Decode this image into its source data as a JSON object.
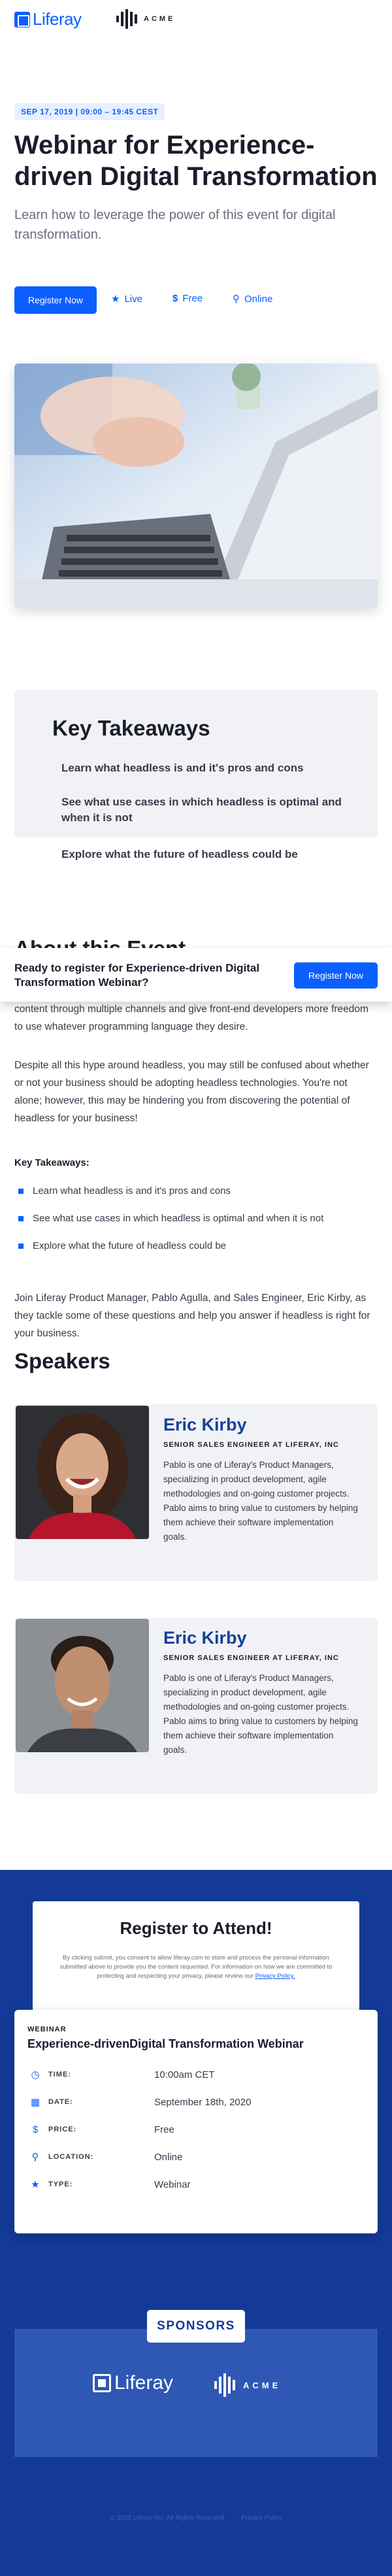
{
  "header": {
    "liferay": "Liferay",
    "acme": "ACME"
  },
  "hero": {
    "date": "SEP 17, 2019 | 09:00 – 19:45 CEST",
    "title": "Webinar for Experience-driven Digital Transformation",
    "subtitle": "Learn how to leverage the power of this event for digital transformation.",
    "register_label": "Register Now",
    "meta": [
      {
        "icon": "star-icon",
        "label": "Live"
      },
      {
        "icon": "dollar-icon",
        "label": "Free"
      },
      {
        "icon": "location-pin-icon",
        "label": "Online"
      }
    ]
  },
  "takeaways": {
    "title": "Key Takeaways",
    "items": [
      "Learn what headless is and it's pros and cons",
      "See what use cases in which headless is optimal and when it is not",
      "Explore what the future of headless could be"
    ]
  },
  "about": {
    "title": "About this Event",
    "para1": "content through multiple channels and give front-end developers more freedom to use whatever programming language they desire.",
    "para2": "Despite all this hype around headless, you may still be confused about whether or not your business should be adopting headless technologies. You're not alone; however, this may be hindering you from discovering the potential of headless for your business!",
    "kt_label": "Key Takeaways:",
    "bullets": [
      "Learn what headless is and it's pros and cons",
      "See what use cases in which headless is optimal and when it is not",
      "Explore what the future of headless could be"
    ],
    "para3": "Join Liferay Product Manager, Pablo Agulla, and Sales Engineer, Eric Kirby, as they tackle some of these questions and help you answer if headless is right for your business."
  },
  "sticky": {
    "question": "Ready to register for Experience-driven Digital Transformation Webinar?",
    "register_label": "Register Now"
  },
  "speakers": {
    "title": "Speakers",
    "list": [
      {
        "name": "Eric Kirby",
        "role": "SENIOR SALES ENGINEER AT LIFERAY, INC",
        "bio": "Pablo is one of Liferay's Product Managers, specializing in product development, agile methodologies and on-going customer projects. Pablo aims to bring value to customers by helping them achieve their software implementation goals."
      },
      {
        "name": "Eric Kirby",
        "role": "SENIOR SALES ENGINEER AT LIFERAY, INC",
        "bio": "Pablo is one of Liferay's Product Managers, specializing in product development, agile methodologies and on-going customer projects. Pablo aims to bring value to customers by helping them achieve their software implementation goals."
      }
    ]
  },
  "register": {
    "title": "Register to Attend!",
    "legal": "By clicking submit, you consent to allow liferay.com to store and process the personal information submitted above to provide you the content requested. For information on how we are committed to protecting and respecting your privacy, please review our",
    "privacy_link": "Privacy Policy."
  },
  "info": {
    "label": "WEBINAR",
    "title": "Experience-drivenDigital Transformation Webinar",
    "rows": [
      {
        "icon": "clock-icon",
        "key": "TIME:",
        "value": "10:00am CET"
      },
      {
        "icon": "calendar-icon",
        "key": "DATE:",
        "value": "September 18th, 2020"
      },
      {
        "icon": "dollar-icon",
        "key": "PRICE:",
        "value": "Free"
      },
      {
        "icon": "location-pin-icon",
        "key": "LOCATION:",
        "value": "Online"
      },
      {
        "icon": "star-icon",
        "key": "TYPE:",
        "value": "Webinar"
      }
    ]
  },
  "sponsors": {
    "title": "SPONSORS",
    "liferay": "Liferay",
    "acme": "ACME"
  },
  "footer": {
    "copyright": "© 2020 Liferay Inc. All Rights Reserved",
    "privacy": "Privacy Policy"
  },
  "colors": {
    "brand_blue": "#0b5fff",
    "dark_navy": "#123a96",
    "panel_grey": "#f1f2f5"
  }
}
